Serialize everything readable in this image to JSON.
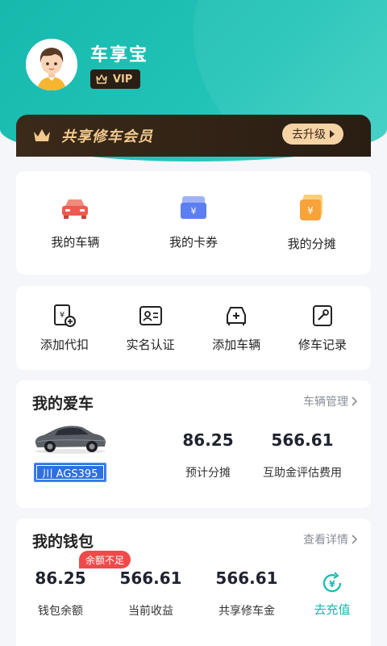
{
  "user": {
    "name": "车享宝",
    "badge": "VIP"
  },
  "member": {
    "title": "共享修车会员",
    "upgrade_label": "去升级"
  },
  "quick_grid": [
    {
      "label": "我的车辆",
      "icon": "car-icon"
    },
    {
      "label": "我的卡券",
      "icon": "coupon-icon"
    },
    {
      "label": "我的分摊",
      "icon": "share-cost-icon"
    }
  ],
  "services": [
    {
      "label": "添加代扣",
      "icon": "auto-debit-icon"
    },
    {
      "label": "实名认证",
      "icon": "id-card-icon"
    },
    {
      "label": "添加车辆",
      "icon": "add-car-icon"
    },
    {
      "label": "修车记录",
      "icon": "repair-record-icon"
    }
  ],
  "my_car": {
    "title": "我的爱车",
    "link": "车辆管理",
    "plate": "川 AGS395",
    "stats": [
      {
        "value": "86.25",
        "label": "预计分摊"
      },
      {
        "value": "566.61",
        "label": "互助金评估费用"
      }
    ]
  },
  "wallet": {
    "title": "我的钱包",
    "link": "查看详情",
    "warning": "余额不足",
    "stats": [
      {
        "value": "86.25",
        "label": "钱包余额"
      },
      {
        "value": "566.61",
        "label": "当前收益"
      },
      {
        "value": "566.61",
        "label": "共享修车金"
      }
    ],
    "recharge_label": "去充值"
  },
  "colors": {
    "accent": "#17b8ad",
    "gold": "#f2c98f",
    "warn": "#ef4a4a",
    "plate": "#2f6fe0"
  }
}
